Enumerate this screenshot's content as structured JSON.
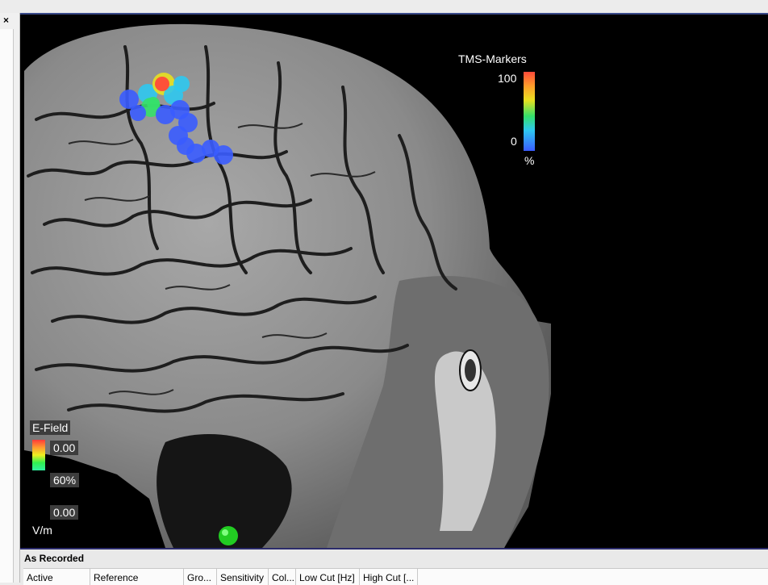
{
  "window": {
    "close_glyph": "×"
  },
  "tms_legend": {
    "title": "TMS-Markers",
    "max": "100",
    "min": "0",
    "unit": "%"
  },
  "efield_legend": {
    "title": "E-Field",
    "top": "0.00",
    "mid": "60%",
    "bottom": "0.00",
    "unit": "V/m"
  },
  "bottom_panel": {
    "title": "As Recorded",
    "columns": [
      "Active",
      "Reference",
      "Gro...",
      "Sensitivity",
      "Col...",
      "Low Cut [Hz]",
      "High Cut [..."
    ]
  },
  "colors": {
    "viewport_bg": "#000000",
    "panel_border": "#2b2b6b",
    "green_marker": "#22cc22"
  }
}
